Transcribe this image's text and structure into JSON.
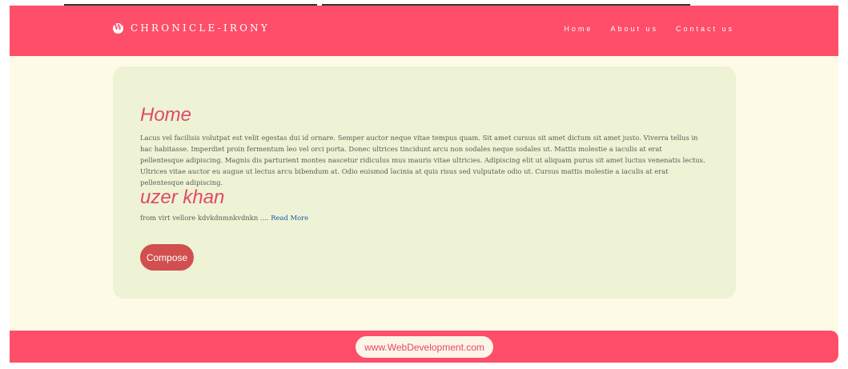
{
  "header": {
    "brand_icon": "W",
    "brand_name": "CHRONICLE-IRONY",
    "nav": [
      {
        "label": "Home"
      },
      {
        "label": "About us"
      },
      {
        "label": "Contact us"
      }
    ]
  },
  "main": {
    "posts": [
      {
        "title": "Home",
        "body": "Lacus vel facilisis volutpat est velit egestas dui id ornare. Semper auctor neque vitae tempus quam. Sit amet cursus sit amet dictum sit amet justo. Viverra tellus in hac habitasse. Imperdiet proin fermentum leo vel orci porta. Donec ultrices tincidunt arcu non sodales neque sodales ut. Mattis molestie a iaculis at erat pellentesque adipiscing. Magnis dis parturient montes nascetur ridiculus mus mauris vitae ultricies. Adipiscing elit ut aliquam purus sit amet luctus venenatis lectus. Ultrices vitae auctor eu augue ut lectus arcu bibendum at. Odio euismod lacinia at quis risus sed vulputate odio ut. Cursus mattis molestie a iaculis at erat pellentesque adipiscing."
      },
      {
        "title": "uzer khan",
        "excerpt": "from virt vellore kdvkdnmnkvdnkn ....",
        "read_more": "Read More"
      }
    ],
    "compose_label": "Compose"
  },
  "footer": {
    "text": "www.WebDevelopment.com"
  },
  "colors": {
    "primary": "#fe4e69",
    "background": "#fdfbe5",
    "card": "#edf3d4",
    "title": "#e2486a",
    "button": "#d14f4f",
    "link": "#1e5aa6"
  }
}
